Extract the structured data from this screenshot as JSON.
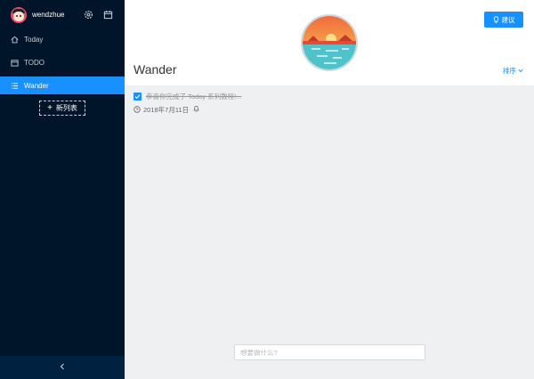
{
  "user": {
    "name": "wendzhue"
  },
  "sidebar": {
    "items": [
      {
        "label": "Today",
        "icon": "home-icon"
      },
      {
        "label": "TODO",
        "icon": "calendar-icon"
      },
      {
        "label": "Wander",
        "icon": "list-icon"
      }
    ],
    "active": "Wander",
    "new_list_label": "新列表",
    "collapse_icon": "chevron-left-icon"
  },
  "header": {
    "suggest_label": "建议",
    "list_title": "Wander",
    "sort_label": "排序"
  },
  "todos": [
    {
      "text": "恭喜你完成了 Today 系列教程!...",
      "date": "2018年7月11日",
      "done": true
    }
  ],
  "input": {
    "placeholder": "想要做什么?"
  },
  "colors": {
    "sidebar_bg": "#001529",
    "accent": "#1890ff",
    "main_bg": "#eef0f2"
  }
}
